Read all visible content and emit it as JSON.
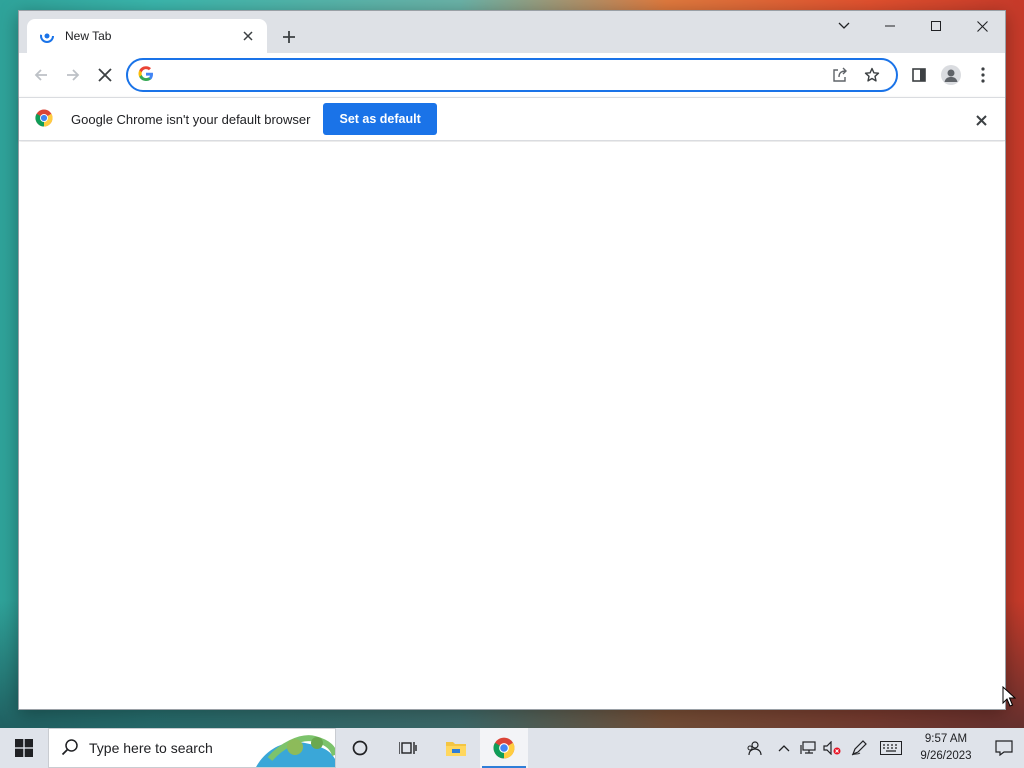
{
  "browser": {
    "tab": {
      "title": "New Tab"
    },
    "omnibox": {
      "value": "",
      "placeholder": ""
    },
    "infobar": {
      "message": "Google Chrome isn't your default browser",
      "button_label": "Set as default"
    }
  },
  "taskbar": {
    "search_placeholder": "Type here to search",
    "clock": {
      "time": "9:57 AM",
      "date": "9/26/2023"
    },
    "apps": [
      "cortana",
      "task-view",
      "file-explorer",
      "chrome"
    ]
  },
  "colors": {
    "accent": "#1a73e8",
    "titlebar": "#dee1e6",
    "taskbar": "#dfe3ea"
  }
}
